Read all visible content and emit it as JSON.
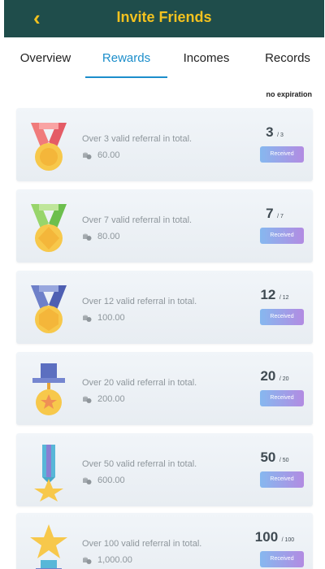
{
  "header": {
    "title": "Invite Friends",
    "back_icon": "chevron-left-icon"
  },
  "tabs": [
    {
      "label": "Overview"
    },
    {
      "label": "Rewards"
    },
    {
      "label": "Incomes"
    },
    {
      "label": "Records"
    }
  ],
  "active_tab": "Rewards",
  "note": "no expiration",
  "colors": {
    "header_bg": "#1f4d4b",
    "accent": "#f3c21f",
    "active_tab": "#1c8ecb"
  },
  "rewards": [
    {
      "desc": "Over 3 valid referral in total.",
      "amount": "60.00",
      "progress": "3",
      "target": "/ 3",
      "status": "Received"
    },
    {
      "desc": "Over 7 valid referral in total.",
      "amount": "80.00",
      "progress": "7",
      "target": "/ 7",
      "status": "Received"
    },
    {
      "desc": "Over 12 valid referral in total.",
      "amount": "100.00",
      "progress": "12",
      "target": "/ 12",
      "status": "Received"
    },
    {
      "desc": "Over 20 valid referral in total.",
      "amount": "200.00",
      "progress": "20",
      "target": "/ 20",
      "status": "Received"
    },
    {
      "desc": "Over 50 valid referral in total.",
      "amount": "600.00",
      "progress": "50",
      "target": "/ 50",
      "status": "Received"
    },
    {
      "desc": "Over 100 valid referral in total.",
      "amount": "1,000.00",
      "progress": "100",
      "target": "/ 100",
      "status": "Received"
    }
  ]
}
